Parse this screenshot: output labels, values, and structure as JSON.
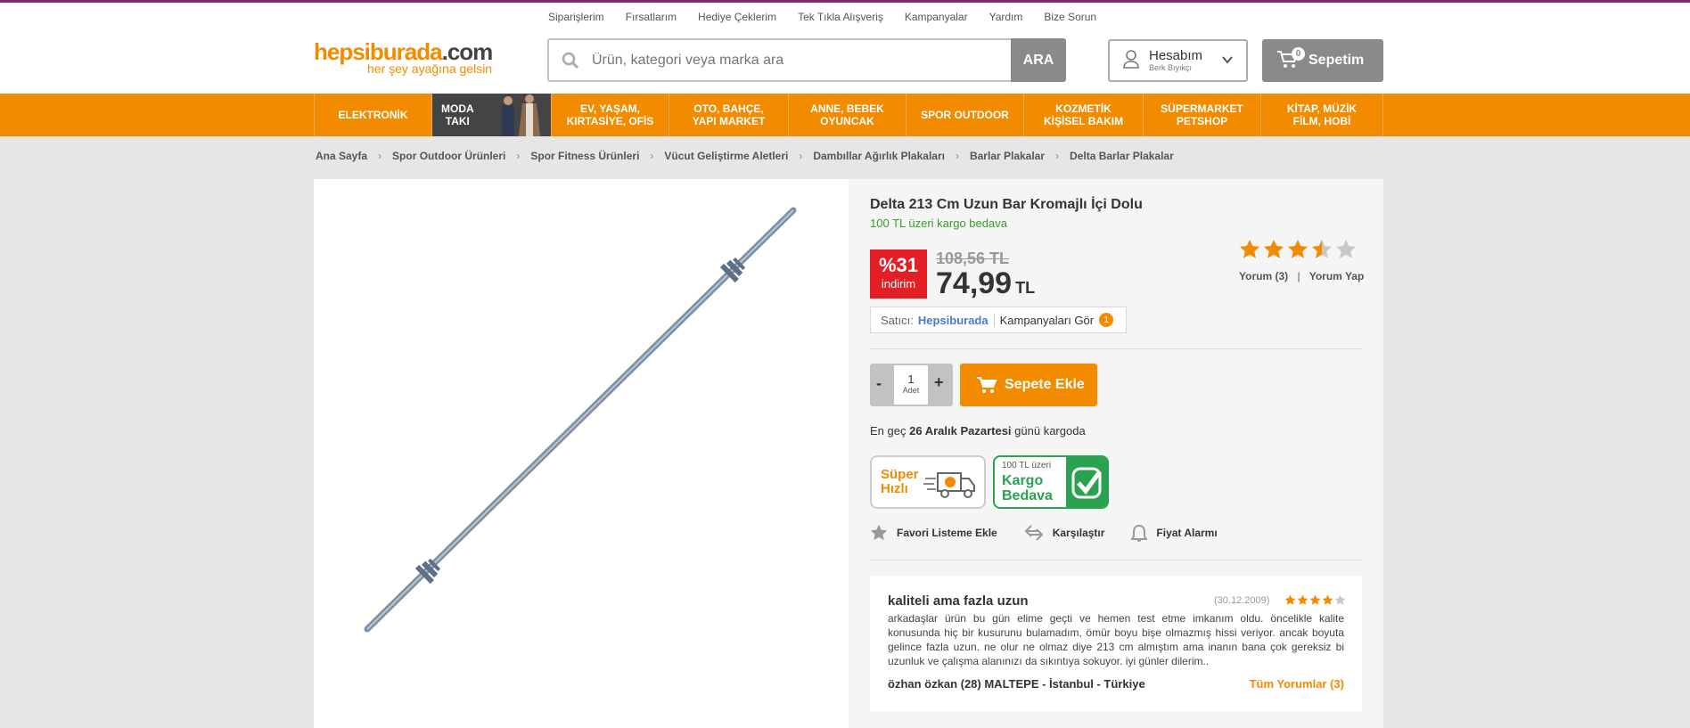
{
  "top_links": [
    "Siparişlerim",
    "Fırsatlarım",
    "Hediye Çeklerim",
    "Tek Tıkla Alışveriş",
    "Kampanyalar",
    "Yardım",
    "Bize Sorun"
  ],
  "logo": {
    "name": "hepsiburada",
    "com": ".com",
    "tagline": "her şey ayağına gelsin"
  },
  "search": {
    "placeholder": "Ürün, kategori veya marka ara",
    "button": "ARA"
  },
  "account": {
    "label": "Hesabım",
    "user": "Berk Bıyıkçı"
  },
  "cart": {
    "label": "Sepetim",
    "count": "0"
  },
  "nav": [
    {
      "l1": "ELEKTRONİK",
      "l2": ""
    },
    {
      "l1": "MODA",
      "l2": "TAKI"
    },
    {
      "l1": "EV, YAŞAM,",
      "l2": "KIRTASİYE, OFİS"
    },
    {
      "l1": "OTO, BAHÇE,",
      "l2": "YAPI MARKET"
    },
    {
      "l1": "ANNE, BEBEK",
      "l2": "OYUNCAK"
    },
    {
      "l1": "SPOR OUTDOOR",
      "l2": ""
    },
    {
      "l1": "KOZMETİK",
      "l2": "KİŞİSEL BAKIM"
    },
    {
      "l1": "SÜPERMARKET",
      "l2": "PETSHOP"
    },
    {
      "l1": "KİTAP, MÜZİK",
      "l2": "FİLM, HOBİ"
    }
  ],
  "breadcrumb": [
    "Ana Sayfa",
    "Spor Outdoor Ürünleri",
    "Spor Fitness Ürünleri",
    "Vücut Geliştirme Aletleri",
    "Dambıllar Ağırlık Plakaları",
    "Barlar Plakalar",
    "Delta Barlar Plakalar"
  ],
  "product": {
    "title": "Delta 213 Cm Uzun Bar Kromajlı İçi Dolu",
    "free_shipping": "100 TL üzeri kargo bedava",
    "discount_pct": "%31",
    "discount_label": "indirim",
    "old_price": "108,56 TL",
    "price": "74,99",
    "currency": "TL",
    "rating": 3.5,
    "reviews_label": "Yorum (3)",
    "review_sep": "|",
    "write_review": "Yorum Yap"
  },
  "seller": {
    "label": "Satıcı:",
    "name": "Hepsiburada",
    "campaigns": "Kampanyaları Gör",
    "campaign_count": "1"
  },
  "quantity": {
    "minus": "-",
    "value": "1",
    "unit": "Adet",
    "plus": "+"
  },
  "add_to_cart": "Sepete Ekle",
  "delivery": {
    "prefix": "En geç",
    "date": "26 Aralık Pazartesi",
    "suffix": "günü kargoda"
  },
  "badges": {
    "super_1": "Süper",
    "super_2": "Hızlı",
    "kb_small": "100 TL üzeri",
    "kb_1": "Kargo",
    "kb_2": "Bedava"
  },
  "actions": [
    "Favori Listeme Ekle",
    "Karşılaştır",
    "Fiyat Alarmı"
  ],
  "review": {
    "title": "kaliteli ama fazla uzun",
    "date": "(30.12.2009)",
    "stars": 4,
    "body": "arkadaşlar ürün bu gün elime geçti ve hemen test etme imkanım oldu. öncelikle kalite konusunda hiç bir kusurunu bulamadım, ömür boyu bişe olmazmış hissi veriyor. ancak boyuta gelince fazla uzun. ne olur ne olmaz diye 213 cm almıştım ama inanın bana çok gereksiz bi uzunluk ve çalışma alanınızı da sıkıntıya sokuyor. iyi günler dilerim..",
    "author": "özhan özkan (28) MALTEPE - İstanbul - Türkiye",
    "all": "Tüm Yorumlar (3)"
  },
  "colors": {
    "brand": "#f28b00",
    "sale": "#e31e24",
    "green": "#2aa251",
    "link": "#4a7bc4"
  }
}
